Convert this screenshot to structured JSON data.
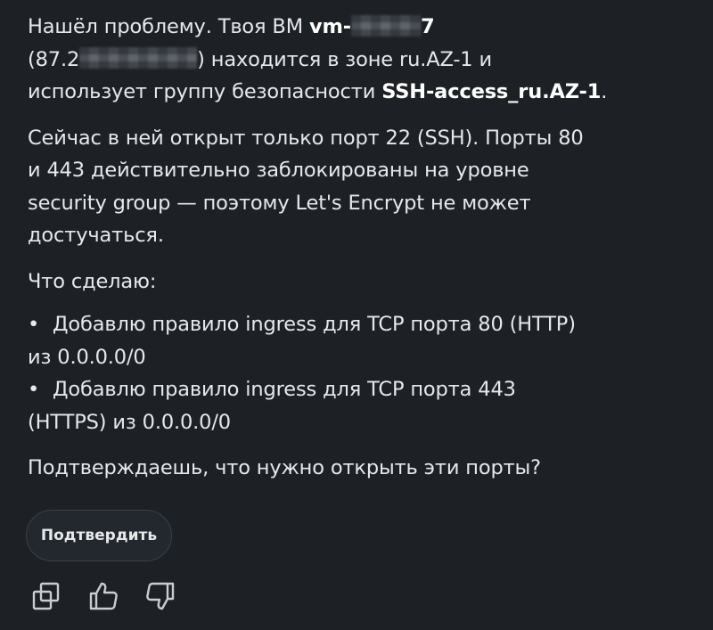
{
  "message": {
    "para1": {
      "t1": "Нашёл проблему. Твоя ВМ ",
      "vm_prefix": "vm-",
      "vm_tail": "7",
      "ip_prefix": "(87.2",
      "ip_suffix": ") находится в зоне ru.AZ-1 и",
      "line3": "использует группу безопасности ",
      "sg_name": "SSH-access_ru.AZ-1",
      "period": "."
    },
    "para2_lines": [
      "Сейчас в ней открыт только порт 22 (SSH). Порты 80",
      "и 443 действительно заблокированы на уровне",
      "security group — поэтому Let's Encrypt не может",
      "достучаться."
    ],
    "plan_heading": "Что сделаю:",
    "bullet_marker": "•",
    "bullets": [
      {
        "line1": "Добавлю правило ingress для TCP порта 80 (HTTP)",
        "line2": "из 0.0.0.0/0"
      },
      {
        "line1": "Добавлю правило ingress для TCP порта 443",
        "line2": "(HTTPS) из 0.0.0.0/0"
      }
    ],
    "question": "Подтверждаешь, что нужно открыть эти порты?"
  },
  "confirm_button": {
    "label": "Подтвердить"
  },
  "actions": [
    "copy-icon",
    "thumbs-up-icon",
    "thumbs-down-icon"
  ],
  "colors": {
    "background": "#1d2126",
    "text": "#e6e8eb",
    "button_bg": "#23282e",
    "button_border": "#3a4047",
    "icon": "#c9cdd2"
  }
}
